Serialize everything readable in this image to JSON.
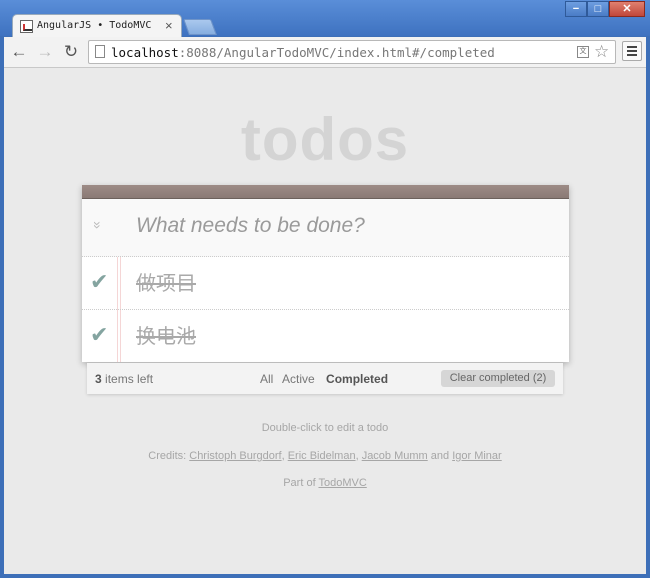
{
  "browser": {
    "tab_title": "AngularJS • TodoMVC",
    "tab_close": "×",
    "url_host": "localhost",
    "url_rest": ":8088/AngularTodoMVC/index.html#/completed",
    "back_icon": "←",
    "forward_icon": "→",
    "reload_icon": "↻",
    "star_icon": "☆",
    "translate_icon": "文",
    "win_min": "−",
    "win_max": "□",
    "win_close": "✕"
  },
  "app": {
    "title": "todos",
    "new_todo_placeholder": "What needs to be done?",
    "toggle_all_icon": "»",
    "check_icon": "✔",
    "todos": [
      {
        "text": "做项目",
        "completed": true
      },
      {
        "text": "换电池",
        "completed": true
      }
    ],
    "footer": {
      "count": "3",
      "count_suffix": " items left",
      "filters": [
        "All",
        "Active",
        "Completed"
      ],
      "selected_filter": "Completed",
      "clear_label": "Clear completed (2)"
    }
  },
  "info": {
    "edit_hint": "Double-click to edit a todo",
    "credits_prefix": "Credits: ",
    "authors": [
      "Christoph Burgdorf",
      "Eric Bidelman",
      "Jacob Mumm",
      "Igor Minar"
    ],
    "and_word": " and ",
    "comma": ", ",
    "part_of": "Part of ",
    "todomvc": "TodoMVC"
  },
  "colors": {
    "header_bar": "#8a7a75",
    "check": "#84a4a0",
    "title": "#d4d4d4"
  }
}
